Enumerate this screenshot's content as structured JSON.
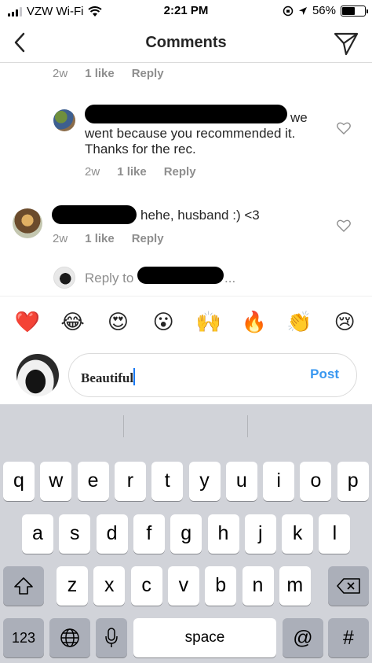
{
  "status_bar": {
    "carrier": "VZW Wi-Fi",
    "time": "2:21 PM",
    "battery_percent": "56%",
    "battery_level": 0.56,
    "icons": [
      "signal-icon",
      "wifi-icon",
      "rotation-lock-icon",
      "location-icon",
      "battery-icon"
    ]
  },
  "header": {
    "title": "Comments",
    "back_icon": "chevron-left-icon",
    "send_icon": "direct-send-icon"
  },
  "comments": [
    {
      "time": "2w",
      "likes": "1 like",
      "reply": "Reply"
    },
    {
      "text_line1": "we",
      "text_line2": "went because you recommended it.",
      "text_line3": "Thanks for the rec.",
      "time": "2w",
      "likes": "1 like",
      "reply": "Reply"
    },
    {
      "text": "hehe, husband :) <3",
      "time": "2w",
      "likes": "1 like",
      "reply": "Reply"
    }
  ],
  "reply_to": {
    "text": "Reply to",
    "suffix": "..."
  },
  "emoji_bar": [
    "❤️",
    "😂",
    "😍",
    "😮",
    "🙌",
    "🔥",
    "👏",
    "😢"
  ],
  "composer": {
    "value": "Beautiful",
    "post_label": "Post"
  },
  "keyboard": {
    "row1": [
      "q",
      "w",
      "e",
      "r",
      "t",
      "y",
      "u",
      "i",
      "o",
      "p"
    ],
    "row2": [
      "a",
      "s",
      "d",
      "f",
      "g",
      "h",
      "j",
      "k",
      "l"
    ],
    "row3": [
      "z",
      "x",
      "c",
      "v",
      "b",
      "n",
      "m"
    ],
    "numbers": "123",
    "space": "space",
    "at": "@",
    "hash": "#"
  },
  "colors": {
    "accent": "#3897f0",
    "muted": "#8e8e8e",
    "caret": "#1878f3",
    "keyboard_bg": "#d1d3d9"
  }
}
